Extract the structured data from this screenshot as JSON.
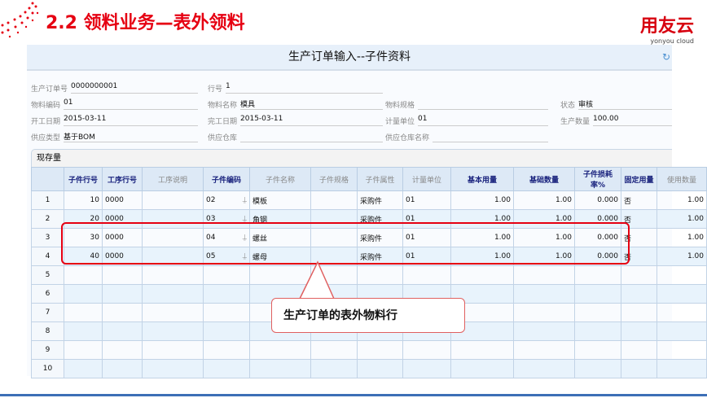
{
  "slide": {
    "title": "2.2 领料业务—表外领料",
    "logo_cn": "用友云",
    "logo_en": "yonyou cloud"
  },
  "window": {
    "title": "生产订单输入--子件资料"
  },
  "form": [
    {
      "label": "生产订单号",
      "value": "0000000001"
    },
    {
      "label": "行号",
      "value": "1"
    },
    {
      "label": "物料编码",
      "value": "01"
    },
    {
      "label": "物料名称",
      "value": "模具"
    },
    {
      "label": "物料规格",
      "value": ""
    },
    {
      "label": "状态",
      "value": "审核"
    },
    {
      "label": "开工日期",
      "value": "2015-03-11"
    },
    {
      "label": "完工日期",
      "value": "2015-03-11"
    },
    {
      "label": "计量单位",
      "value": "01"
    },
    {
      "label": "生产数量",
      "value": "100.00"
    },
    {
      "label": "供应类型",
      "value": "基于BOM"
    },
    {
      "label": "供应仓库",
      "value": ""
    },
    {
      "label": "供应仓库名称",
      "value": ""
    }
  ],
  "section": "现存量",
  "columns": [
    "",
    "子件行号",
    "工序行号",
    "工序说明",
    "子件编码",
    "子件名称",
    "子件规格",
    "子件属性",
    "计量单位",
    "基本用量",
    "基础数量",
    "子件损耗率%",
    "固定用量",
    "使用数量"
  ],
  "rows": [
    [
      "1",
      "10",
      "0000",
      "",
      "02",
      "模板",
      "",
      "采购件",
      "01",
      "1.00",
      "1.00",
      "0.000",
      "否",
      "1.00"
    ],
    [
      "2",
      "20",
      "0000",
      "",
      "03",
      "角钢",
      "",
      "采购件",
      "01",
      "1.00",
      "1.00",
      "0.000",
      "否",
      "1.00"
    ],
    [
      "3",
      "30",
      "0000",
      "",
      "04",
      "螺丝",
      "",
      "采购件",
      "01",
      "1.00",
      "1.00",
      "0.000",
      "否",
      "1.00"
    ],
    [
      "4",
      "40",
      "0000",
      "",
      "05",
      "螺母",
      "",
      "采购件",
      "01",
      "1.00",
      "1.00",
      "0.000",
      "否",
      "1.00"
    ],
    [
      "5",
      "",
      "",
      "",
      "",
      "",
      "",
      "",
      "",
      "",
      "",
      "",
      "",
      ""
    ],
    [
      "6",
      "",
      "",
      "",
      "",
      "",
      "",
      "",
      "",
      "",
      "",
      "",
      "",
      ""
    ],
    [
      "7",
      "",
      "",
      "",
      "",
      "",
      "",
      "",
      "",
      "",
      "",
      "",
      "",
      ""
    ],
    [
      "8",
      "",
      "",
      "",
      "",
      "",
      "",
      "",
      "",
      "",
      "",
      "",
      "",
      ""
    ],
    [
      "9",
      "",
      "",
      "",
      "",
      "",
      "",
      "",
      "",
      "",
      "",
      "",
      "",
      ""
    ],
    [
      "10",
      "",
      "",
      "",
      "",
      "",
      "",
      "",
      "",
      "",
      "",
      "",
      "",
      ""
    ]
  ],
  "callout": "生产订单的表外物料行",
  "colors": {
    "accent": "#e60012",
    "header": "#e7f0fa"
  }
}
